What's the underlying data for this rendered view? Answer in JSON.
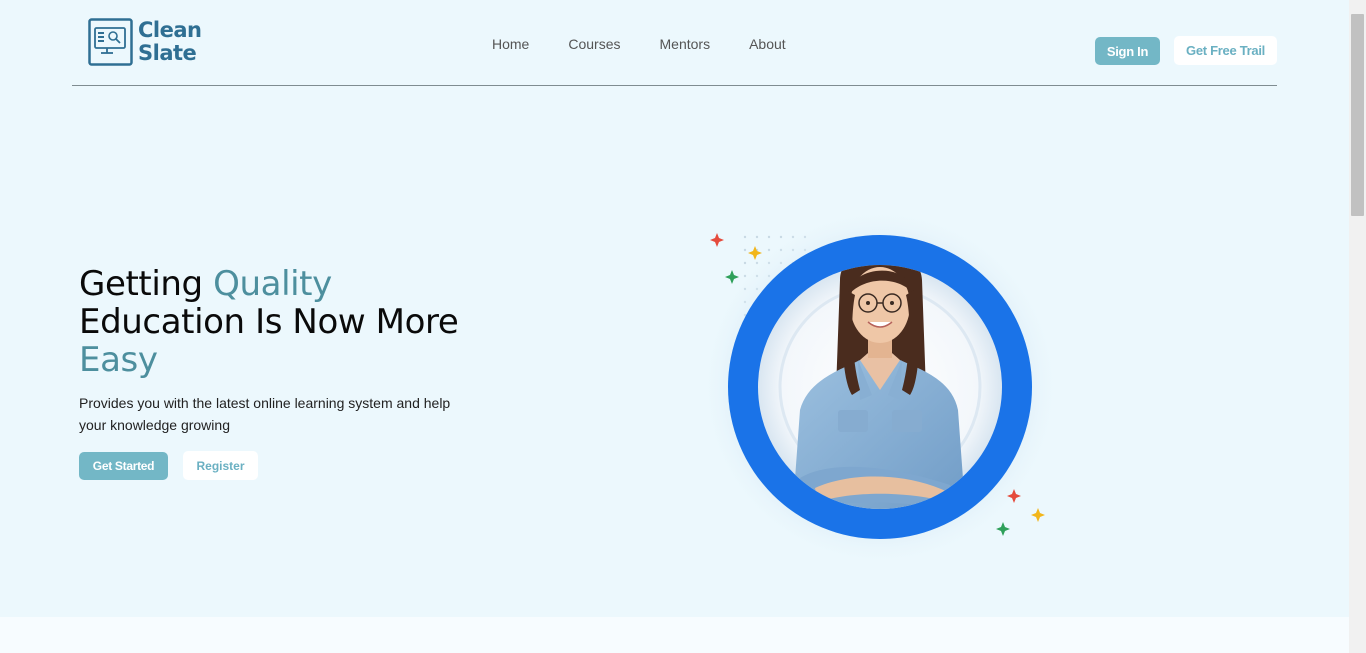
{
  "brand": {
    "line1": "Clean",
    "line2": "Slate",
    "color": "#2f6f93"
  },
  "nav": {
    "items": [
      {
        "label": "Home"
      },
      {
        "label": "Courses"
      },
      {
        "label": "Mentors"
      },
      {
        "label": "About"
      }
    ],
    "signin_label": "Sign In",
    "trial_label": "Get Free Trail"
  },
  "hero": {
    "headline_part1": "Getting ",
    "headline_accent1": "Quality",
    "headline_part2": "Education Is Now More",
    "headline_accent2": "Easy",
    "subtext": "Provides you with the latest online learning system and help your knowledge growing",
    "primary_button": "Get Started",
    "secondary_button": "Register"
  },
  "colors": {
    "accent": "#73b7c6",
    "headline_accent": "#4d8f9e",
    "ring": "#1a73e8",
    "background": "#ecf8fd"
  },
  "icons": {
    "logo": "monitor-icon",
    "sparkles": [
      "red-sparkle-icon",
      "yellow-sparkle-icon",
      "green-sparkle-icon"
    ]
  }
}
